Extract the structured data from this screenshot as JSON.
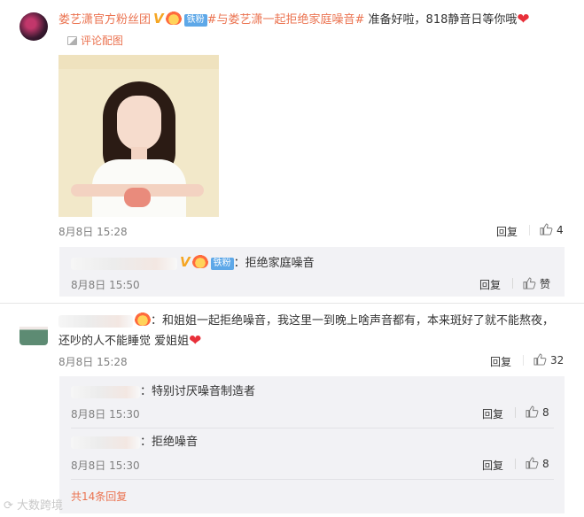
{
  "post": {
    "user_name": "娄艺潇官方粉丝团",
    "badge_fan": "铁粉",
    "topic": "#与娄艺潇一起拒绝家庭噪音#",
    "text": " 准备好啦，818静音日等你哦",
    "pic_link_icon": "image-icon",
    "pic_link": "评论配图",
    "time": "8月8日 15:28",
    "reply_label": "回复",
    "likes": "4",
    "reply": {
      "badge_fan": "铁粉",
      "text": "：拒绝家庭噪音",
      "time": "8月8日 15:50",
      "reply_label": "回复",
      "like_label": "赞"
    }
  },
  "comment2": {
    "text_line1": "：和姐姐一起拒绝噪音，我这里一到晚上啥声音都有，本来斑好了就不能熬夜，",
    "text_line2": "还吵的人不能睡觉 爱姐姐",
    "time": "8月8日 15:28",
    "reply_label": "回复",
    "likes": "32",
    "replies": [
      {
        "text": "：特别讨厌噪音制造者",
        "time": "8月8日 15:30",
        "reply_label": "回复",
        "likes": "8"
      },
      {
        "text": "：拒绝噪音",
        "time": "8月8日 15:30",
        "reply_label": "回复",
        "likes": "8"
      }
    ],
    "more_link": "共14条回复"
  },
  "watermark": "大数跨境",
  "colors": {
    "link": "#eb7350",
    "meta": "#808080",
    "reply_bg": "#f2f2f5"
  }
}
